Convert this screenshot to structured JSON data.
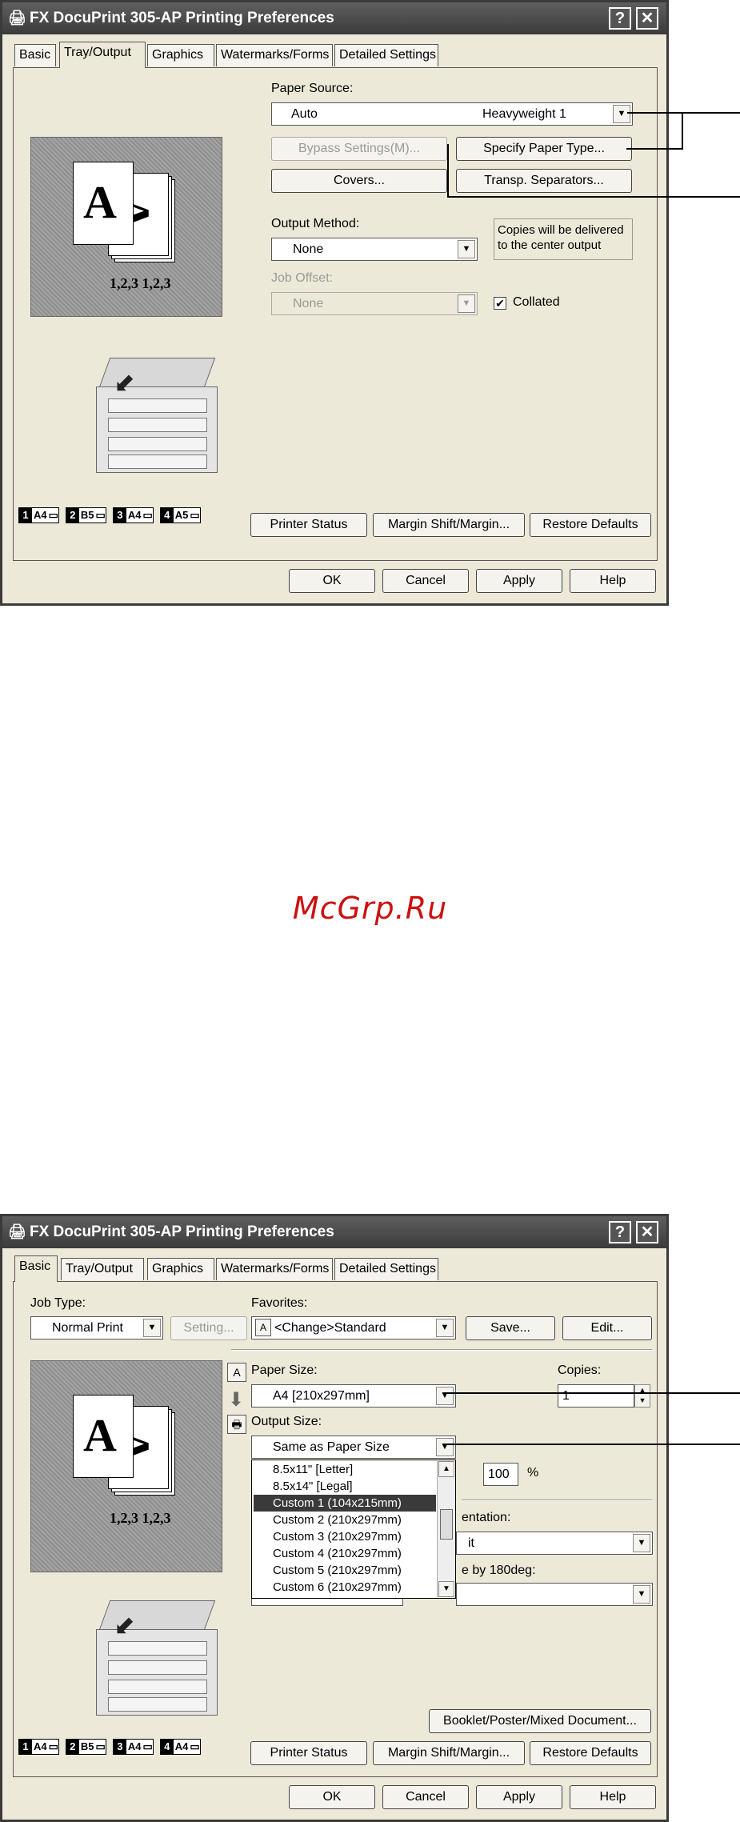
{
  "watermark": "McGrp.Ru",
  "window1": {
    "title": "FX DocuPrint 305-AP Printing Preferences",
    "help_btn": "?",
    "close_btn": "✕",
    "tabs": [
      "Basic",
      "Tray/Output",
      "Graphics",
      "Watermarks/Forms",
      "Detailed Settings"
    ],
    "active_tab": 1,
    "paper_source_label": "Paper Source:",
    "paper_source_value": "Auto",
    "paper_source_type": "Heavyweight 1",
    "bypass_btn": "Bypass Settings(M)...",
    "specify_btn": "Specify Paper Type...",
    "covers_btn": "Covers...",
    "transp_btn": "Transp. Separators...",
    "output_method_label": "Output Method:",
    "output_method_value": "None",
    "output_note": "Copies will be delivered to the center output",
    "job_offset_label": "Job Offset:",
    "job_offset_value": "None",
    "collated_label": "Collated",
    "collate_caption": "1,2,3  1,2,3",
    "sheet_letter": "A",
    "trays": [
      {
        "num": "1",
        "size": "A4"
      },
      {
        "num": "2",
        "size": "B5"
      },
      {
        "num": "3",
        "size": "A4"
      },
      {
        "num": "4",
        "size": "A5"
      }
    ],
    "printer_status_btn": "Printer Status",
    "margin_btn": "Margin Shift/Margin...",
    "restore_btn": "Restore Defaults",
    "ok_btn": "OK",
    "cancel_btn": "Cancel",
    "apply_btn": "Apply",
    "help_bottom_btn": "Help"
  },
  "window2": {
    "title": "FX DocuPrint 305-AP Printing Preferences",
    "help_btn": "?",
    "close_btn": "✕",
    "tabs": [
      "Basic",
      "Tray/Output",
      "Graphics",
      "Watermarks/Forms",
      "Detailed Settings"
    ],
    "active_tab": 0,
    "job_type_label": "Job Type:",
    "job_type_value": "Normal Print",
    "setting_btn": "Setting...",
    "favorites_label": "Favorites:",
    "favorites_value": "<Change>Standard",
    "save_btn": "Save...",
    "edit_btn": "Edit...",
    "paper_size_label": "Paper Size:",
    "paper_size_value": "A4 [210x297mm]",
    "copies_label": "Copies:",
    "copies_value": "1",
    "output_size_label": "Output Size:",
    "output_size_value": "Same as Paper Size",
    "zoom_value": "100",
    "zoom_unit": "%",
    "orientation_label_partial": "entation:",
    "orientation_value_partial": "it",
    "rotate_label_partial": "e by 180deg:",
    "dropdown_items": [
      "8.5x11\" [Letter]",
      "8.5x14\" [Legal]",
      "Custom 1 (104x215mm)",
      "Custom 2 (210x297mm)",
      "Custom 3 (210x297mm)",
      "Custom 4 (210x297mm)",
      "Custom 5 (210x297mm)",
      "Custom 6 (210x297mm)"
    ],
    "dropdown_selected": 2,
    "booklet_btn": "Booklet/Poster/Mixed Document...",
    "collate_caption": "1,2,3  1,2,3",
    "sheet_letter": "A",
    "trays": [
      {
        "num": "1",
        "size": "A4"
      },
      {
        "num": "2",
        "size": "B5"
      },
      {
        "num": "3",
        "size": "A4"
      },
      {
        "num": "4",
        "size": "A4"
      }
    ],
    "printer_status_btn": "Printer Status",
    "margin_btn": "Margin Shift/Margin...",
    "restore_btn": "Restore Defaults",
    "ok_btn": "OK",
    "cancel_btn": "Cancel",
    "apply_btn": "Apply",
    "help_bottom_btn": "Help"
  }
}
